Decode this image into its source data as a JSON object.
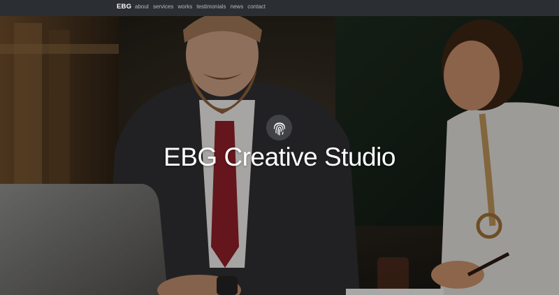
{
  "navbar": {
    "brand": "EBG",
    "links": [
      {
        "label": "about"
      },
      {
        "label": "services"
      },
      {
        "label": "works"
      },
      {
        "label": "testimonials"
      },
      {
        "label": "news"
      },
      {
        "label": "contact"
      }
    ]
  },
  "hero": {
    "title": "EBG Creative Studio",
    "icon": "fingerprint-icon"
  },
  "colors": {
    "navbar_bg": "#2b2f34",
    "nav_link": "#b5b9be",
    "title": "#ffffff"
  }
}
